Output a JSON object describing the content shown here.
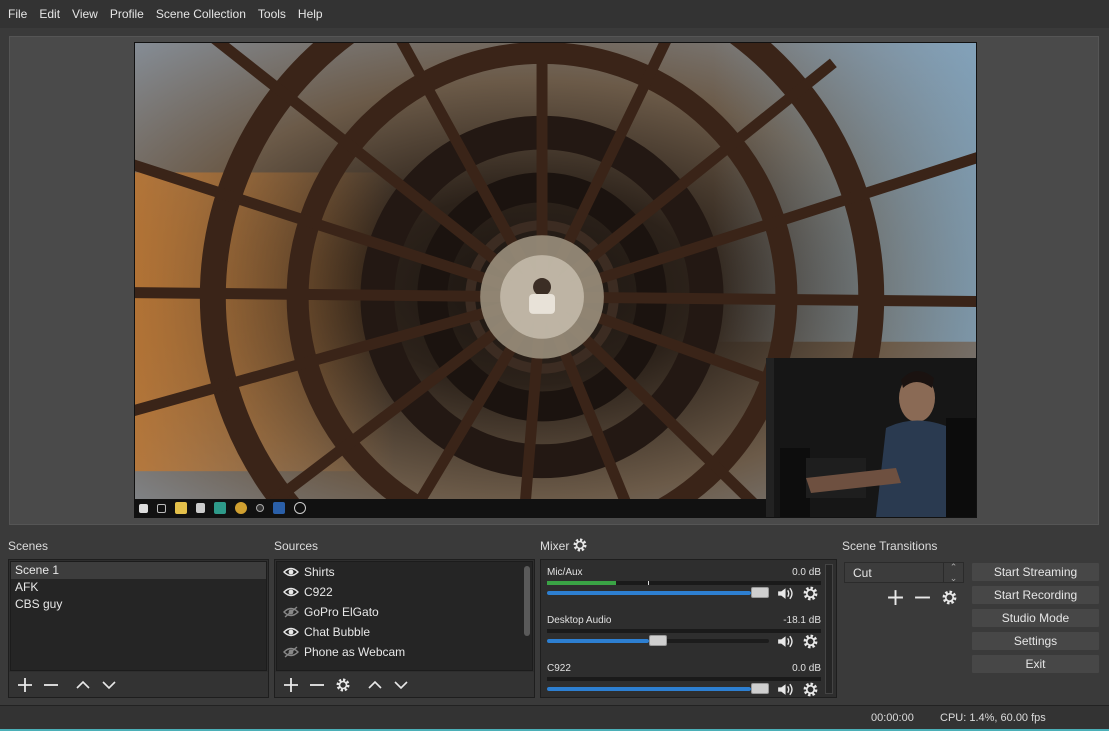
{
  "menu": [
    "File",
    "Edit",
    "View",
    "Profile",
    "Scene Collection",
    "Tools",
    "Help"
  ],
  "docks": {
    "scenes_title": "Scenes",
    "sources_title": "Sources",
    "mixer_title": "Mixer",
    "transitions_title": "Scene Transitions"
  },
  "scenes": [
    {
      "label": "Scene 1",
      "selected": true
    },
    {
      "label": "AFK",
      "selected": false
    },
    {
      "label": "CBS guy",
      "selected": false
    }
  ],
  "sources": [
    {
      "label": "Shirts",
      "visible": true
    },
    {
      "label": "C922",
      "visible": true
    },
    {
      "label": "GoPro ElGato",
      "visible": false
    },
    {
      "label": "Chat Bubble",
      "visible": true
    },
    {
      "label": "Phone as Webcam",
      "visible": false
    }
  ],
  "mixer": [
    {
      "name": "Mic/Aux",
      "db": "0.0 dB",
      "meter_level": 0.25,
      "peak": 0.37,
      "volume": 1.0
    },
    {
      "name": "Desktop Audio",
      "db": "-18.1 dB",
      "meter_level": 0.0,
      "peak": 0.0,
      "volume": 0.5
    },
    {
      "name": "C922",
      "db": "0.0 dB",
      "meter_level": 0.0,
      "peak": 0.0,
      "volume": 1.0
    }
  ],
  "transitions": {
    "selected": "Cut"
  },
  "controls": {
    "start_streaming": "Start Streaming",
    "start_recording": "Start Recording",
    "studio_mode": "Studio Mode",
    "settings": "Settings",
    "exit": "Exit"
  },
  "status": {
    "time": "00:00:00",
    "cpu": "CPU: 1.4%, 60.00 fps"
  },
  "colors": {
    "accent_blue": "#2d7fd1",
    "meter_green": "#3aa345",
    "bottom_edge": "#4bb0b8"
  }
}
